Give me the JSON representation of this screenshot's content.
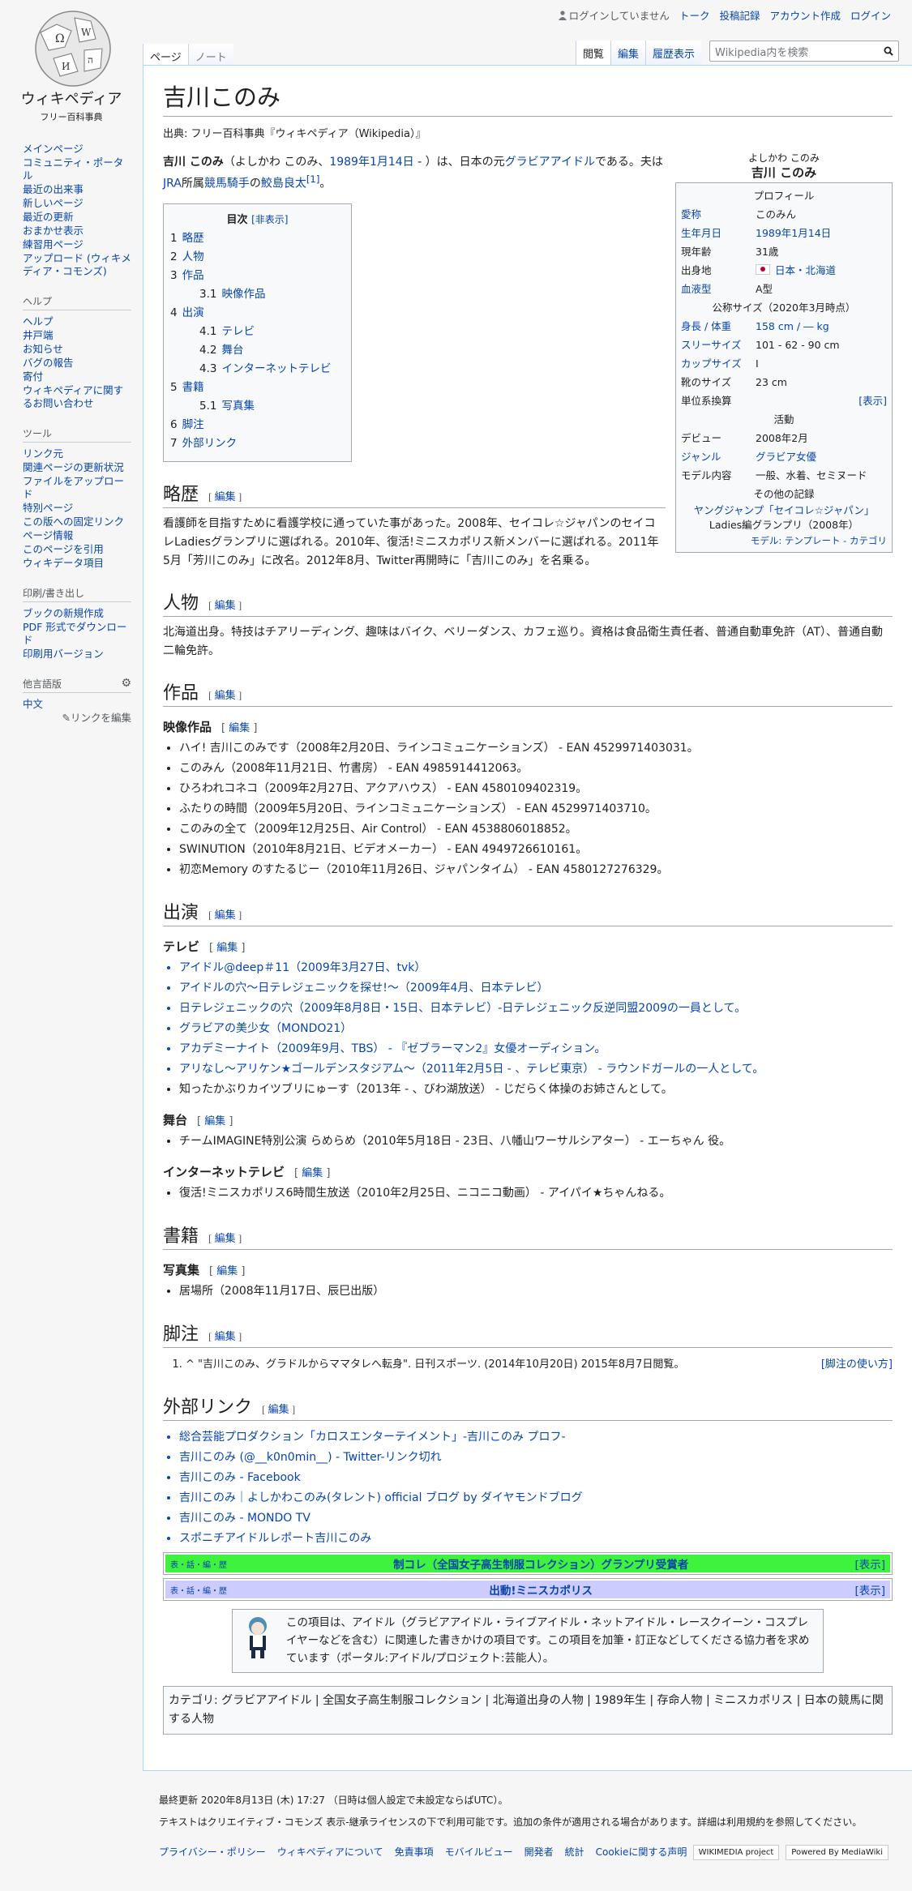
{
  "logo": {
    "name": "ウィキペディア",
    "tagline": "フリー百科事典"
  },
  "personal": [
    "ログインしていません",
    "トーク",
    "投稿記録",
    "アカウント作成",
    "ログイン"
  ],
  "tabs_left": [
    "ページ",
    "ノート"
  ],
  "tabs_right": [
    "閲覧",
    "編集",
    "履歴表示"
  ],
  "search_placeholder": "Wikipedia内を検索",
  "sidebar": {
    "main": [
      "メインページ",
      "コミュニティ・ポータル",
      "最近の出来事",
      "新しいページ",
      "最近の更新",
      "おまかせ表示",
      "練習用ページ",
      "アップロード (ウィキメディア・コモンズ)"
    ],
    "help_h": "ヘルプ",
    "help": [
      "ヘルプ",
      "井戸端",
      "お知らせ",
      "バグの報告",
      "寄付",
      "ウィキペディアに関するお問い合わせ"
    ],
    "tools_h": "ツール",
    "tools": [
      "リンク元",
      "関連ページの更新状況",
      "ファイルをアップロード",
      "特別ページ",
      "この版への固定リンク",
      "ページ情報",
      "このページを引用",
      "ウィキデータ項目"
    ],
    "print_h": "印刷/書き出し",
    "print": [
      "ブックの新規作成",
      "PDF 形式でダウンロード",
      "印刷用バージョン"
    ],
    "lang_h": "他言語版",
    "lang": [
      "中文"
    ],
    "edit_links": "リンクを編集"
  },
  "title": "吉川このみ",
  "site_sub": "出典: フリー百科事典『ウィキペディア（Wikipedia）』",
  "intro": {
    "name": "吉川 このみ",
    "a": "（よしかわ このみ、",
    "date": "1989年1月14日",
    "b": " - ）は、日本の元",
    "gravure": "グラビアアイドル",
    "c": "である。夫は",
    "jra": "JRA",
    "d": "所属",
    "jockey": "競馬騎手",
    "e": "の",
    "husband": "鮫島良太",
    "ref": "[1]",
    "f": "。"
  },
  "toc": {
    "title": "目次",
    "toggle": "[非表示]",
    "items": [
      {
        "n": "1",
        "t": "略歴",
        "l": 1
      },
      {
        "n": "2",
        "t": "人物",
        "l": 1
      },
      {
        "n": "3",
        "t": "作品",
        "l": 1
      },
      {
        "n": "3.1",
        "t": "映像作品",
        "l": 2
      },
      {
        "n": "4",
        "t": "出演",
        "l": 1
      },
      {
        "n": "4.1",
        "t": "テレビ",
        "l": 2
      },
      {
        "n": "4.2",
        "t": "舞台",
        "l": 2
      },
      {
        "n": "4.3",
        "t": "インターネットテレビ",
        "l": 2
      },
      {
        "n": "5",
        "t": "書籍",
        "l": 1
      },
      {
        "n": "5.1",
        "t": "写真集",
        "l": 2
      },
      {
        "n": "6",
        "t": "脚注",
        "l": 1
      },
      {
        "n": "7",
        "t": "外部リンク",
        "l": 1
      }
    ]
  },
  "infobox": {
    "kana": "よしかわ このみ",
    "name": "吉川 このみ",
    "profile": "プロフィール",
    "rows": [
      {
        "k": "愛称",
        "v": "このみん"
      },
      {
        "k": "生年月日",
        "v": "1989年1月14日"
      },
      {
        "k": "現年齢",
        "v": "31歳"
      },
      {
        "k": "出身地",
        "v": "日本・北海道"
      },
      {
        "k": "血液型",
        "v": "A型"
      }
    ],
    "size_h": "公称サイズ（2020年3月時点）",
    "rows2": [
      {
        "k": "身長 / 体重",
        "v": "158 cm / ― kg"
      },
      {
        "k": "スリーサイズ",
        "v": "101 - 62 - 90 cm"
      },
      {
        "k": "カップサイズ",
        "v": "I"
      },
      {
        "k": "靴のサイズ",
        "v": "23 cm"
      },
      {
        "k": "単位系換算",
        "v": "[表示]"
      }
    ],
    "act_h": "活動",
    "rows3": [
      {
        "k": "デビュー",
        "v": "2008年2月"
      },
      {
        "k": "ジャンル",
        "v": "グラビア女優"
      },
      {
        "k": "モデル内容",
        "v": "一般、水着、セミヌード"
      }
    ],
    "other_h": "その他の記録",
    "other1": "ヤングジャンプ「セイコレ☆ジャパン」",
    "other2": "Ladies編グランプリ（2008年）",
    "foot": "モデル: テンプレート - カテゴリ"
  },
  "edit": "編集",
  "h_bio": "略歴",
  "bio": "看護師を目指すために看護学校に通っていた事があった。2008年、セイコレ☆ジャパンのセイコレLadiesグランプリに選ばれる。2010年、復活!ミニスカポリス新メンバーに選ばれる。2011年5月「芳川このみ」に改名。2012年8月、Twitter再開時に「吉川このみ」を名乗る。",
  "h_person": "人物",
  "person": "北海道出身。特技はチアリーディング、趣味はバイク、ベリーダンス、カフェ巡り。資格は食品衛生責任者、普通自動車免許（AT）、普通自動二輪免許。",
  "h_works": "作品",
  "h_video": "映像作品",
  "videos": [
    "ハイ! 吉川このみです（2008年2月20日、ラインコミュニケーションズ） - EAN 4529971403031。",
    "このみん（2008年11月21日、竹書房） - EAN 4985914412063。",
    "ひろわれコネコ（2009年2月27日、アクアハウス） - EAN 4580109402319。",
    "ふたりの時間（2009年5月20日、ラインコミュニケーションズ） - EAN 4529971403710。",
    "このみの全て（2009年12月25日、Air Control） - EAN 4538806018852。",
    "SWINUTION（2010年8月21日、ビデオメーカー） - EAN 4949726610161。",
    "初恋Memory のすたるじー（2010年11月26日、ジャパンタイム） - EAN 4580127276329。"
  ],
  "h_appear": "出演",
  "h_tv": "テレビ",
  "tv": [
    "アイドル@deep＃11（2009年3月27日、tvk）",
    "アイドルの穴〜日テレジェニックを探せ!〜（2009年4月、日本テレビ）",
    "日テレジェニックの穴（2009年8月8日・15日、日本テレビ）-日テレジェニック反逆同盟2009の一員として。",
    "グラビアの美少女（MONDO21）",
    "アカデミーナイト（2009年9月、TBS） - 『ゼブラーマン2』女優オーディション。",
    "アリなし〜アリケン★ゴールデンスタジアム〜（2011年2月5日 - 、テレビ東京） - ラウンドガールの一人として。",
    "知ったかぶりカイツブリにゅーす（2013年 - 、びわ湖放送） - じだらく体操のお姉さんとして。"
  ],
  "h_stage": "舞台",
  "stage": [
    "チームIMAGINE特別公演 らめらめ（2010年5月18日 - 23日、八幡山ワーサルシアター） - エーちゃん 役。"
  ],
  "h_net": "インターネットテレビ",
  "net": [
    "復活!ミニスカポリス6時間生放送（2010年2月25日、ニコニコ動画） - アイパイ★ちゃんねる。"
  ],
  "h_books": "書籍",
  "h_photo": "写真集",
  "photo": [
    "居場所（2008年11月17日、辰巳出版）"
  ],
  "h_notes": "脚注",
  "note": "^ \"吉川このみ、グラドルからママタレへ転身\". 日刊スポーツ. (2014年10月20日) 2015年8月7日閲覧。",
  "note_usage": "[脚注の使い方]",
  "h_ext": "外部リンク",
  "ext": [
    "総合芸能プロダクション「カロスエンターテイメント」-吉川このみ プロフ-",
    "吉川このみ (@__k0n0min__) - Twitter-リンク切れ",
    "吉川このみ - Facebook",
    "吉川このみ｜よしかわこのみ(タレント) official ブログ by ダイヤモンドブログ",
    "吉川このみ - MONDO TV",
    "スポニチアイドルレポート吉川このみ"
  ],
  "nav1": {
    "vte": "表・話・編・歴",
    "title": "制コレ（全国女子高生制服コレクション）グランプリ受賞者",
    "show": "[表示]",
    "color": "#3ef23e"
  },
  "nav2": {
    "vte": "表・話・編・歴",
    "title": "出動!ミニスカポリス",
    "show": "[表示]",
    "color": "#ccccff"
  },
  "ambox": "この項目は、アイドル（グラビアアイドル・ライブアイドル・ネットアイドル・レースクイーン・コスプレイヤーなどを含む）に関連した書きかけの項目です。この項目を加筆・訂正などしてくださる協力者を求めています（ポータル:アイドル/プロジェクト:芸能人）。",
  "categories": "カテゴリ: グラビアアイドル | 全国女子高生制服コレクション | 北海道出身の人物 | 1989年生 | 存命人物 | ミニスカポリス | 日本の競馬に関する人物",
  "footer": {
    "updated": "最終更新 2020年8月13日 (木) 17:27 （日時は個人設定で未設定ならばUTC）。",
    "license": "テキストはクリエイティブ・コモンズ 表示-継承ライセンスの下で利用可能です。追加の条件が適用される場合があります。詳細は利用規約を参照してください。",
    "links": [
      "プライバシー・ポリシー",
      "ウィキペディアについて",
      "免責事項",
      "モバイルビュー",
      "開発者",
      "統計",
      "Cookieに関する声明"
    ],
    "badge1": "WIKIMEDIA project",
    "badge2": "Powered By MediaWiki"
  }
}
